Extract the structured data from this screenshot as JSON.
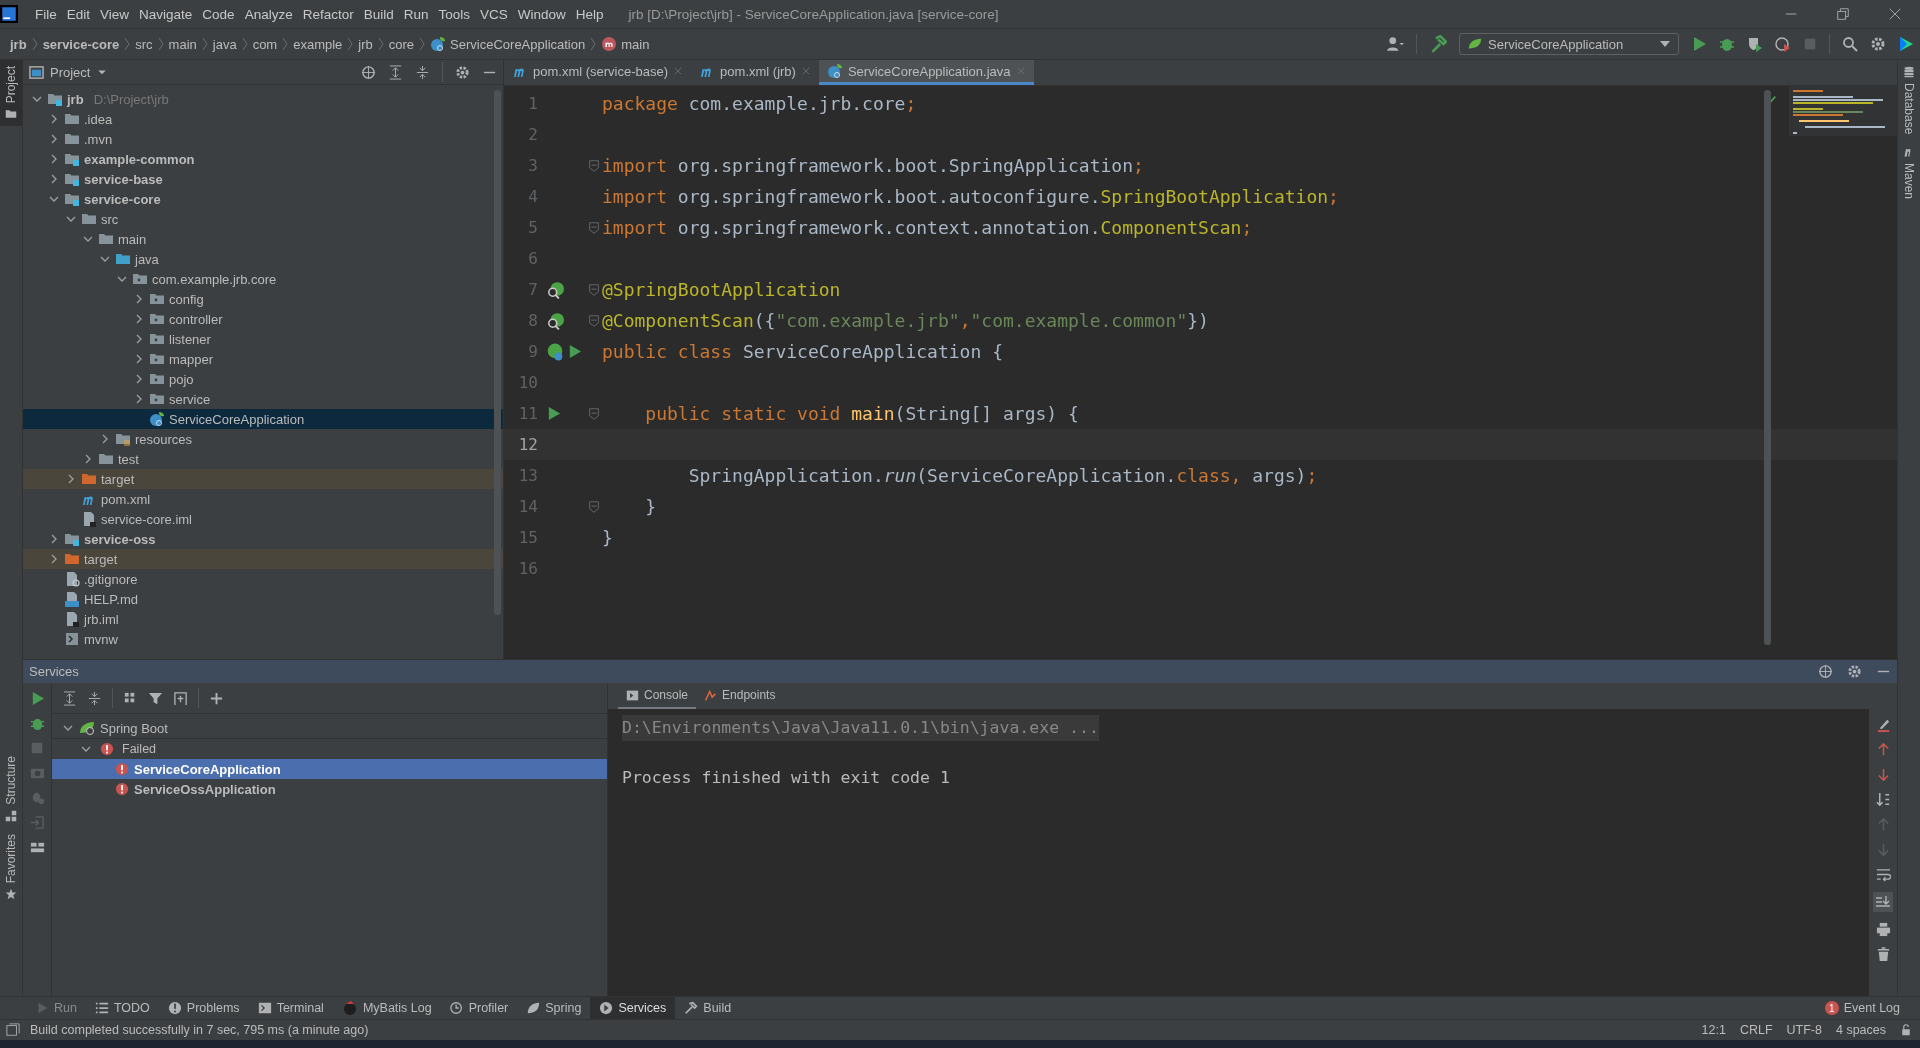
{
  "window": {
    "title": "jrb [D:\\Project\\jrb] - ServiceCoreApplication.java [service-core]"
  },
  "menu": [
    "File",
    "Edit",
    "View",
    "Navigate",
    "Code",
    "Analyze",
    "Refactor",
    "Build",
    "Run",
    "Tools",
    "VCS",
    "Window",
    "Help"
  ],
  "breadcrumbs": [
    {
      "label": "jrb",
      "kind": "project"
    },
    {
      "label": "service-core",
      "kind": "module"
    },
    {
      "label": "src",
      "kind": "plain"
    },
    {
      "label": "main",
      "kind": "plain"
    },
    {
      "label": "java",
      "kind": "plain"
    },
    {
      "label": "com",
      "kind": "plain"
    },
    {
      "label": "example",
      "kind": "plain"
    },
    {
      "label": "jrb",
      "kind": "plain"
    },
    {
      "label": "core",
      "kind": "plain"
    },
    {
      "label": "ServiceCoreApplication",
      "kind": "class"
    },
    {
      "label": "main",
      "kind": "method"
    }
  ],
  "run_config": {
    "label": "ServiceCoreApplication"
  },
  "left_strip": [
    {
      "label": "Project",
      "kind": "top",
      "selected": true
    },
    {
      "label": "Structure",
      "kind": "bottom",
      "selected": false
    },
    {
      "label": "Favorites",
      "kind": "bottom",
      "selected": false
    }
  ],
  "right_strip": [
    {
      "label": "Database",
      "kind": "database"
    },
    {
      "label": "Maven",
      "kind": "maven"
    }
  ],
  "project": {
    "title": "Project",
    "tree": [
      {
        "label": "jrb",
        "hint": "D:\\Project\\jrb",
        "kind": "module",
        "expanded": true,
        "selected": false,
        "children": [
          {
            "label": ".idea",
            "kind": "folder",
            "expanded": false,
            "selected": false
          },
          {
            "label": ".mvn",
            "kind": "folder",
            "expanded": false,
            "selected": false
          },
          {
            "label": "example-common",
            "kind": "module",
            "expanded": false,
            "selected": false
          },
          {
            "label": "service-base",
            "kind": "module",
            "expanded": false,
            "selected": false
          },
          {
            "label": "service-core",
            "kind": "module",
            "expanded": true,
            "selected": false,
            "children": [
              {
                "label": "src",
                "kind": "folder",
                "expanded": true,
                "selected": false,
                "children": [
                  {
                    "label": "main",
                    "kind": "folder",
                    "expanded": true,
                    "selected": false,
                    "children": [
                      {
                        "label": "java",
                        "kind": "source-folder",
                        "expanded": true,
                        "selected": false,
                        "children": [
                          {
                            "label": "com.example.jrb.core",
                            "kind": "package",
                            "expanded": true,
                            "selected": false,
                            "children": [
                              {
                                "label": "config",
                                "kind": "package",
                                "expanded": false,
                                "selected": false
                              },
                              {
                                "label": "controller",
                                "kind": "package",
                                "expanded": false,
                                "selected": false
                              },
                              {
                                "label": "listener",
                                "kind": "package",
                                "expanded": false,
                                "selected": false
                              },
                              {
                                "label": "mapper",
                                "kind": "package",
                                "expanded": false,
                                "selected": false
                              },
                              {
                                "label": "pojo",
                                "kind": "package",
                                "expanded": false,
                                "selected": false
                              },
                              {
                                "label": "service",
                                "kind": "package",
                                "expanded": false,
                                "selected": false
                              },
                              {
                                "label": "ServiceCoreApplication",
                                "kind": "spring-class",
                                "selected": true
                              }
                            ]
                          }
                        ]
                      },
                      {
                        "label": "resources",
                        "kind": "resources",
                        "expanded": false,
                        "selected": false
                      }
                    ]
                  },
                  {
                    "label": "test",
                    "kind": "folder",
                    "expanded": false,
                    "selected": false
                  }
                ]
              },
              {
                "label": "target",
                "kind": "excluded",
                "expanded": false,
                "selected": false
              },
              {
                "label": "pom.xml",
                "kind": "pom",
                "selected": false
              },
              {
                "label": "service-core.iml",
                "kind": "iml",
                "selected": false
              }
            ]
          },
          {
            "label": "service-oss",
            "kind": "module",
            "expanded": false,
            "selected": false
          },
          {
            "label": "target",
            "kind": "excluded",
            "expanded": false,
            "selected": false
          },
          {
            "label": ".gitignore",
            "kind": "gitignore",
            "selected": false
          },
          {
            "label": "HELP.md",
            "kind": "md",
            "selected": false
          },
          {
            "label": "jrb.iml",
            "kind": "iml",
            "selected": false
          },
          {
            "label": "mvnw",
            "kind": "script",
            "selected": false
          }
        ]
      }
    ]
  },
  "editor": {
    "tabs": [
      {
        "label": "pom.xml (service-base)",
        "kind": "pom",
        "selected": false
      },
      {
        "label": "pom.xml (jrb)",
        "kind": "pom",
        "selected": false
      },
      {
        "label": "ServiceCoreApplication.java",
        "kind": "spring-class",
        "selected": true
      }
    ],
    "lines": [
      {
        "number": "1",
        "fold": false,
        "current": false,
        "tokens": [
          {
            "text": "package",
            "kind": "keyword"
          },
          {
            "text": " com.example.jrb.core",
            "kind": "plain"
          },
          {
            "text": ";",
            "kind": "keyword"
          }
        ]
      },
      {
        "number": "2",
        "fold": false,
        "current": false
      },
      {
        "number": "3",
        "fold": true,
        "current": false,
        "tokens": [
          {
            "text": "import",
            "kind": "keyword"
          },
          {
            "text": " org.springframework.boot.SpringApplication",
            "kind": "plain"
          },
          {
            "text": ";",
            "kind": "keyword"
          }
        ]
      },
      {
        "number": "4",
        "fold": false,
        "current": false,
        "tokens": [
          {
            "text": "import",
            "kind": "keyword"
          },
          {
            "text": " org.springframework.boot.autoconfigure.",
            "kind": "plain"
          },
          {
            "text": "SpringBootApplication",
            "kind": "annotation"
          },
          {
            "text": ";",
            "kind": "keyword"
          }
        ]
      },
      {
        "number": "5",
        "fold": true,
        "current": false,
        "tokens": [
          {
            "text": "import",
            "kind": "keyword"
          },
          {
            "text": " org.springframework.context.annotation.",
            "kind": "plain"
          },
          {
            "text": "ComponentScan",
            "kind": "annotation"
          },
          {
            "text": ";",
            "kind": "keyword"
          }
        ]
      },
      {
        "number": "6",
        "fold": false,
        "current": false
      },
      {
        "number": "7",
        "fold": true,
        "current": false,
        "gutter": [
          {
            "kind": "bean-search"
          }
        ],
        "tokens": [
          {
            "text": "@SpringBootApplication",
            "kind": "annotation"
          }
        ]
      },
      {
        "number": "8",
        "fold": true,
        "current": false,
        "gutter": [
          {
            "kind": "bean-search"
          }
        ],
        "tokens": [
          {
            "text": "@ComponentScan",
            "kind": "annotation"
          },
          {
            "text": "({",
            "kind": "plain"
          },
          {
            "text": "\"com.example.jrb\"",
            "kind": "string"
          },
          {
            "text": ",",
            "kind": "keyword"
          },
          {
            "text": "\"com.example.common\"",
            "kind": "string"
          },
          {
            "text": "})",
            "kind": "plain"
          }
        ]
      },
      {
        "number": "9",
        "fold": false,
        "current": false,
        "gutter": [
          {
            "kind": "bean"
          },
          {
            "kind": "run"
          }
        ],
        "tokens": [
          {
            "text": "public class",
            "kind": "keyword"
          },
          {
            "text": " ServiceCoreApplication {",
            "kind": "plain"
          }
        ]
      },
      {
        "number": "10",
        "fold": false,
        "current": false
      },
      {
        "number": "11",
        "fold": true,
        "current": false,
        "gutter": [
          {
            "kind": "run"
          }
        ],
        "tokens": [
          {
            "text": "    public static void",
            "kind": "keyword"
          },
          {
            "text": " main",
            "kind": "method"
          },
          {
            "text": "(String[] args) {",
            "kind": "plain"
          }
        ]
      },
      {
        "number": "12",
        "fold": false,
        "current": true
      },
      {
        "number": "13",
        "fold": false,
        "current": false,
        "tokens": [
          {
            "text": "        SpringApplication.",
            "kind": "plain"
          },
          {
            "text": "run",
            "kind": "static"
          },
          {
            "text": "(ServiceCoreApplication.",
            "kind": "plain"
          },
          {
            "text": "class",
            "kind": "keyword"
          },
          {
            "text": ",",
            "kind": "keyword"
          },
          {
            "text": " args)",
            "kind": "plain"
          },
          {
            "text": ";",
            "kind": "keyword"
          }
        ]
      },
      {
        "number": "14",
        "fold": true,
        "current": false,
        "tokens": [
          {
            "text": "    }",
            "kind": "plain"
          }
        ]
      },
      {
        "number": "15",
        "fold": false,
        "current": false,
        "tokens": [
          {
            "text": "}",
            "kind": "plain"
          }
        ]
      },
      {
        "number": "16",
        "fold": false,
        "current": false
      }
    ]
  },
  "services": {
    "title": "Services",
    "tree": [
      {
        "label": "Spring Boot",
        "kind": "category",
        "expanded": true,
        "selected": false,
        "children": [
          {
            "label": "Failed",
            "kind": "status",
            "expanded": true,
            "selected": false,
            "children": [
              {
                "label": "ServiceCoreApplication",
                "kind": "app",
                "selected": true
              },
              {
                "label": "ServiceOssApplication",
                "kind": "app",
                "selected": false
              }
            ]
          }
        ]
      }
    ],
    "console_tabs": [
      {
        "label": "Console",
        "kind": "console",
        "selected": true
      },
      {
        "label": "Endpoints",
        "kind": "endpoints",
        "selected": false
      }
    ],
    "console_lines": [
      {
        "text": "D:\\Environments\\Java\\Java11.0.1\\bin\\java.exe ...",
        "kind": "command"
      },
      {
        "text": "Process finished with exit code 1",
        "kind": "output"
      }
    ]
  },
  "tool_tabs": [
    {
      "label": "Run",
      "kind": "run",
      "selected": false,
      "disabled": true
    },
    {
      "label": "TODO",
      "kind": "list",
      "selected": false,
      "disabled": false
    },
    {
      "label": "Problems",
      "kind": "problems",
      "selected": false,
      "disabled": false
    },
    {
      "label": "Terminal",
      "kind": "terminal",
      "selected": false,
      "disabled": false
    },
    {
      "label": "MyBatis Log",
      "kind": "bird",
      "selected": false,
      "disabled": false
    },
    {
      "label": "Profiler",
      "kind": "profiler",
      "selected": false,
      "disabled": false
    },
    {
      "label": "Spring",
      "kind": "leaf",
      "selected": false,
      "disabled": false
    },
    {
      "label": "Services",
      "kind": "services",
      "selected": true,
      "disabled": false
    },
    {
      "label": "Build",
      "kind": "hammer",
      "selected": false,
      "disabled": false
    }
  ],
  "event_log": {
    "label": "Event Log",
    "count": "1"
  },
  "status_bar": {
    "message": "Build completed successfully in 7 sec, 795 ms (a minute ago)",
    "items": [
      "12:1",
      "CRLF",
      "UTF-8",
      "4 spaces"
    ]
  }
}
